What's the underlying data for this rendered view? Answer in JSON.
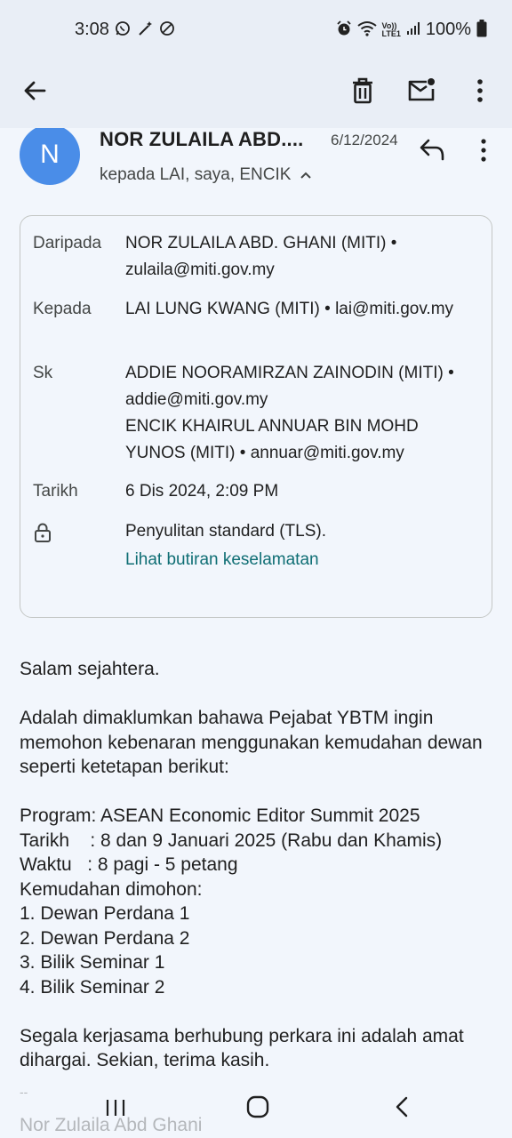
{
  "status_bar": {
    "time": "3:08",
    "left_icons": [
      "whatsapp-icon",
      "magic-wand-icon",
      "do-not-disturb-icon"
    ],
    "right_icons": [
      "alarm-icon",
      "wifi-icon",
      "volte-icon",
      "signal-icon"
    ],
    "volte_label": "Vo))\nLTE1",
    "battery": "100%"
  },
  "app_bar": {
    "icons": [
      "back-arrow-icon",
      "delete-icon",
      "mark-unread-icon",
      "more-vert-icon"
    ]
  },
  "message": {
    "avatar_letter": "N",
    "sender": "NOR ZULAILA ABD....",
    "date": "6/12/2024",
    "recipients": "kepada LAI, saya, ENCIK",
    "details": {
      "from_label": "Daripada",
      "from_value": "NOR ZULAILA ABD. GHANI (MITI) • zulaila@miti.gov.my",
      "to_label": "Kepada",
      "to_value": "LAI LUNG KWANG (MITI) • lai@miti.gov.my",
      "cc_label": "Sk",
      "cc_value_1": "ADDIE NOORAMIRZAN ZAINODIN (MITI) • addie@miti.gov.my",
      "cc_value_2": "ENCIK KHAIRUL ANNUAR BIN MOHD YUNOS (MITI) • annuar@miti.gov.my",
      "date_label": "Tarikh",
      "date_value": "6 Dis 2024, 2:09 PM",
      "security_text": "Penyulitan standard (TLS).",
      "security_link": "Lihat butiran keselamatan"
    },
    "body": {
      "greeting": "Salam sejahtera.",
      "paragraph_1": "Adalah dimaklumkan bahawa Pejabat YBTM ingin memohon kebenaran menggunakan kemudahan dewan seperti ketetapan berikut:",
      "program": "Program: ASEAN Economic Editor Summit 2025",
      "tarikh": "Tarikh    : 8 dan 9 Januari 2025 (Rabu dan Khamis)",
      "waktu": "Waktu   : 8 pagi - 5 petang",
      "facilities_heading": "Kemudahan dimohon:",
      "facilities": [
        "1. Dewan Perdana 1",
        "2. Dewan Perdana 2",
        "3. Bilik Seminar 1",
        "4. Bilik Seminar 2"
      ],
      "closing": "Segala kerjasama berhubung perkara ini adalah amat dihargai. Sekian, terima kasih.",
      "signature_dash": "--",
      "signature_name": "Nor Zulaila Abd Ghani"
    }
  },
  "nav_bar": {
    "icons": [
      "recent-apps-icon",
      "home-icon",
      "nav-back-icon"
    ]
  }
}
